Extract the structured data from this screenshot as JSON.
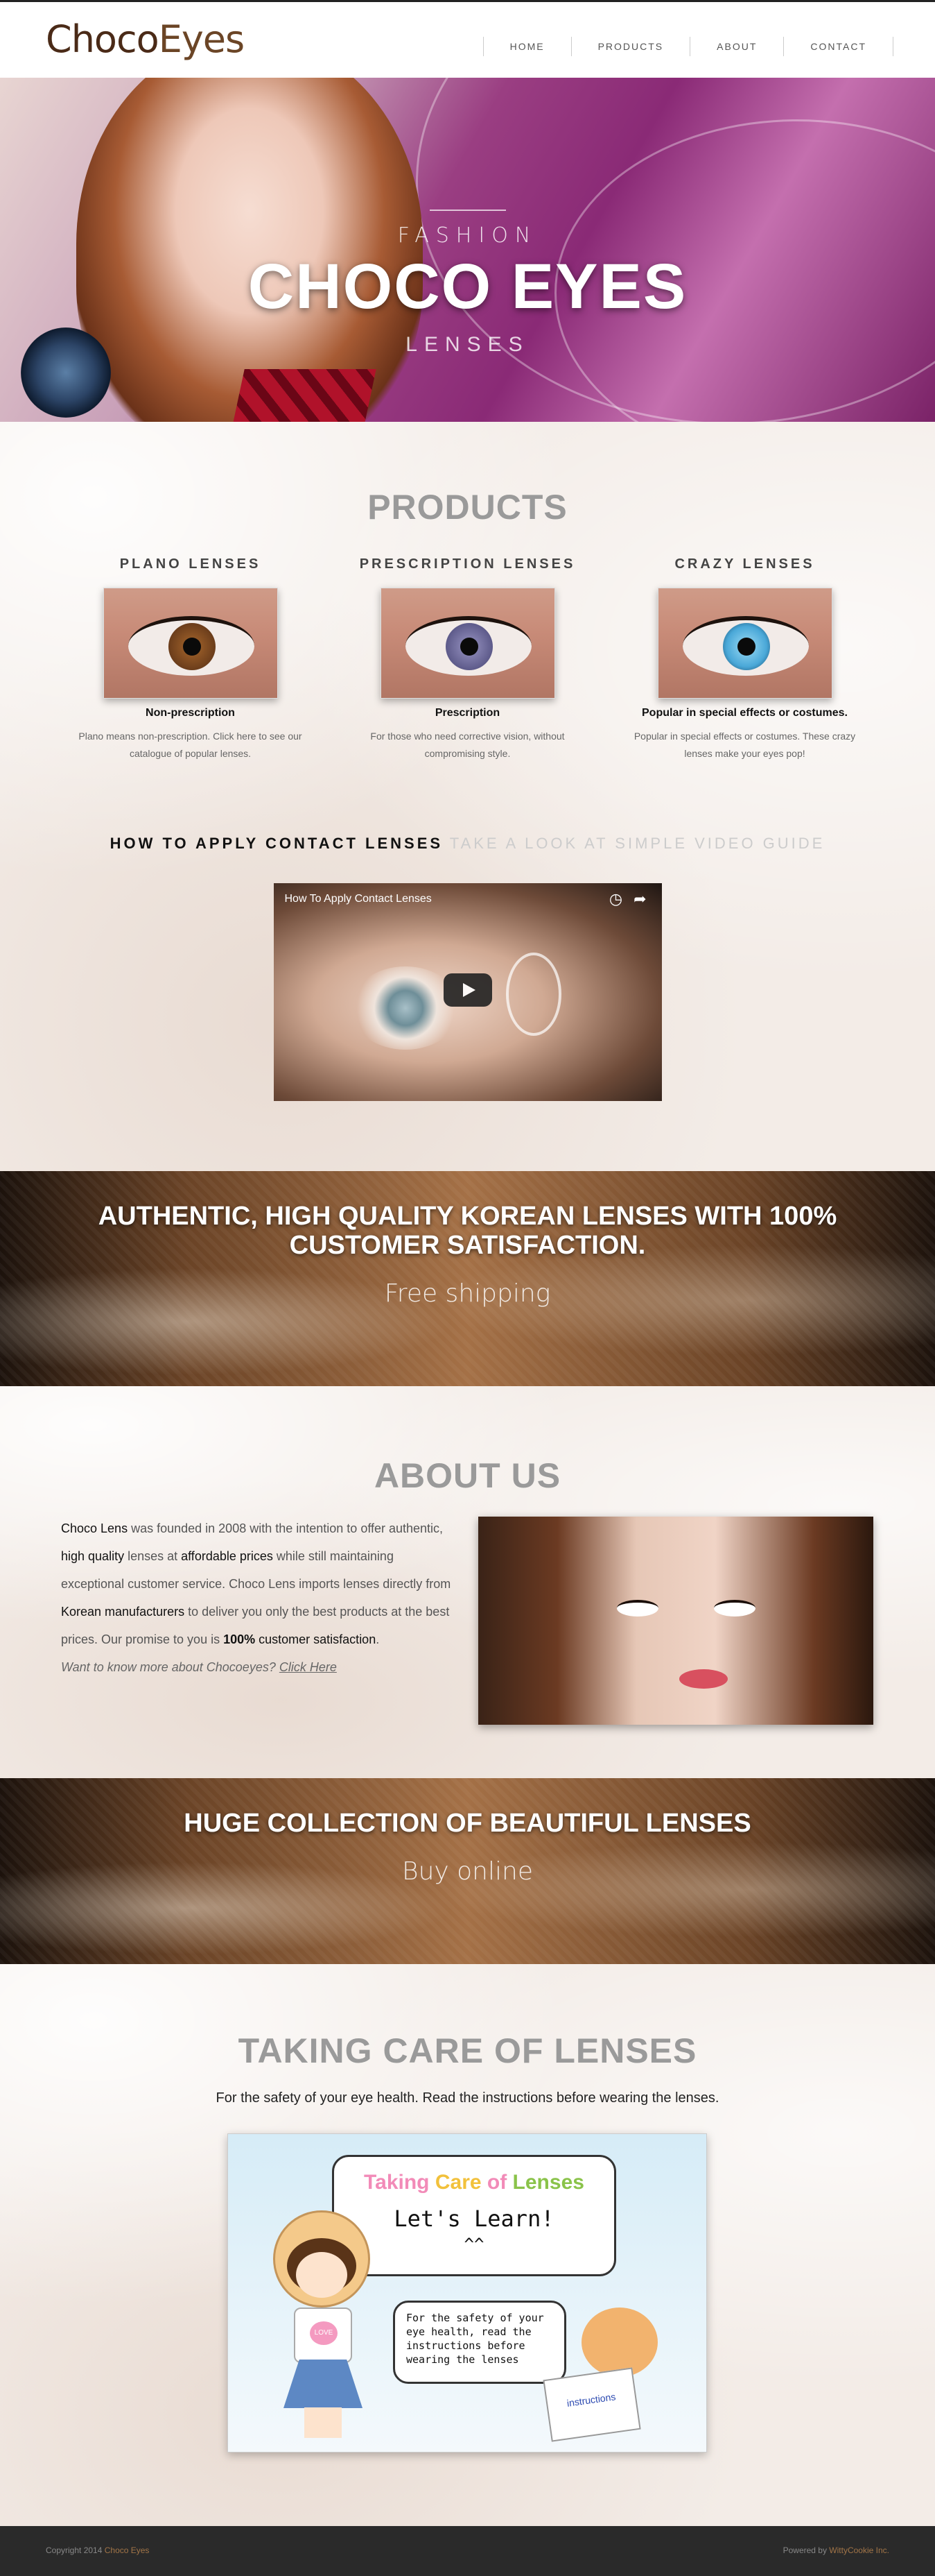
{
  "header": {
    "logo_part1": "Choco",
    "logo_part2": "Eyes",
    "nav": [
      "HOME",
      "PRODUCTS",
      "ABOUT",
      "CONTACT"
    ]
  },
  "hero": {
    "kicker": "FASHION",
    "title": "CHOCO EYES",
    "sub": "LENSES"
  },
  "products": {
    "title": "PRODUCTS",
    "items": [
      {
        "name": "PLANO LENSES",
        "sub": "Non-prescription",
        "desc": "Plano means non-prescription. Click here to see our catalogue of popular lenses.",
        "iris_color": "#6b3d1b"
      },
      {
        "name": "PRESCRIPTION LENSES",
        "sub": "Prescription",
        "desc": "For those who need corrective vision, without compromising style.",
        "iris_color": "#5d5a8a"
      },
      {
        "name": "CRAZY LENSES",
        "sub": "Popular in special effects or costumes.",
        "desc": "Popular in special effects or costumes. These crazy lenses make your eyes pop!",
        "iris_color": "#4aa8d8"
      }
    ]
  },
  "howto": {
    "dark": "HOW TO APPLY CONTACT LENSES",
    "light": "TAKE A LOOK AT SIMPLE VIDEO GUIDE",
    "video_title": "How To Apply Contact Lenses",
    "video_icons": [
      "clock-icon",
      "share-icon"
    ]
  },
  "banner1": {
    "title": "AUTHENTIC, HIGH QUALITY KOREAN LENSES WITH 100% CUSTOMER SATISFACTION.",
    "sub": "Free shipping"
  },
  "about": {
    "title": "ABOUT US",
    "p1_a": "Choco Lens",
    "p1_b": " was founded in 2008 with the intention to offer authentic, ",
    "p1_c": "high quality",
    "p1_d": " lenses at ",
    "p1_e": "affordable prices",
    "p1_f": " while still maintaining exceptional customer service. Choco Lens imports lenses directly from ",
    "p1_g": "Korean manufacturers",
    "p1_h": " to deliver you only the best products at the best prices. Our promise to you is ",
    "p1_i": "100%",
    "p1_j": " customer satisfaction",
    "p1_k": ".",
    "link_prefix": "Want to know more about Chocoeyes? ",
    "link_text": "Click Here"
  },
  "banner2": {
    "title": "HUGE COLLECTION OF BEAUTIFUL LENSES",
    "sub": "Buy online"
  },
  "care": {
    "title": "TAKING CARE OF LENSES",
    "intro": "For the safety of your eye health. Read the instructions before wearing the lenses.",
    "img_t1a": "Taking ",
    "img_t1b": "Care ",
    "img_t1c": "of ",
    "img_t1d": "Lenses",
    "img_t2": "Let's Learn!",
    "img_t3": "^^",
    "img_bubble": "For the safety of your eye health, read the instructions before wearing the lenses",
    "img_heart": "LOVE",
    "img_card": "instructions"
  },
  "footer": {
    "copyright": "Copyright 2014 ",
    "copyright_name": "Choco Eyes",
    "powered": "Powered by ",
    "powered_name": "WittyCookie Inc."
  }
}
